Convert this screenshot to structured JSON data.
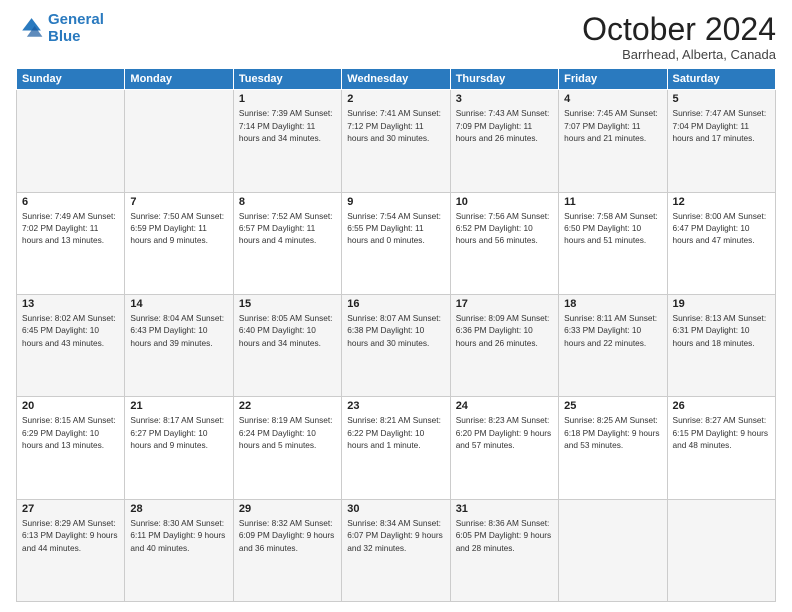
{
  "logo": {
    "line1": "General",
    "line2": "Blue"
  },
  "title": "October 2024",
  "location": "Barrhead, Alberta, Canada",
  "days_header": [
    "Sunday",
    "Monday",
    "Tuesday",
    "Wednesday",
    "Thursday",
    "Friday",
    "Saturday"
  ],
  "weeks": [
    [
      {
        "day": "",
        "info": ""
      },
      {
        "day": "",
        "info": ""
      },
      {
        "day": "1",
        "info": "Sunrise: 7:39 AM\nSunset: 7:14 PM\nDaylight: 11 hours\nand 34 minutes."
      },
      {
        "day": "2",
        "info": "Sunrise: 7:41 AM\nSunset: 7:12 PM\nDaylight: 11 hours\nand 30 minutes."
      },
      {
        "day": "3",
        "info": "Sunrise: 7:43 AM\nSunset: 7:09 PM\nDaylight: 11 hours\nand 26 minutes."
      },
      {
        "day": "4",
        "info": "Sunrise: 7:45 AM\nSunset: 7:07 PM\nDaylight: 11 hours\nand 21 minutes."
      },
      {
        "day": "5",
        "info": "Sunrise: 7:47 AM\nSunset: 7:04 PM\nDaylight: 11 hours\nand 17 minutes."
      }
    ],
    [
      {
        "day": "6",
        "info": "Sunrise: 7:49 AM\nSunset: 7:02 PM\nDaylight: 11 hours\nand 13 minutes."
      },
      {
        "day": "7",
        "info": "Sunrise: 7:50 AM\nSunset: 6:59 PM\nDaylight: 11 hours\nand 9 minutes."
      },
      {
        "day": "8",
        "info": "Sunrise: 7:52 AM\nSunset: 6:57 PM\nDaylight: 11 hours\nand 4 minutes."
      },
      {
        "day": "9",
        "info": "Sunrise: 7:54 AM\nSunset: 6:55 PM\nDaylight: 11 hours\nand 0 minutes."
      },
      {
        "day": "10",
        "info": "Sunrise: 7:56 AM\nSunset: 6:52 PM\nDaylight: 10 hours\nand 56 minutes."
      },
      {
        "day": "11",
        "info": "Sunrise: 7:58 AM\nSunset: 6:50 PM\nDaylight: 10 hours\nand 51 minutes."
      },
      {
        "day": "12",
        "info": "Sunrise: 8:00 AM\nSunset: 6:47 PM\nDaylight: 10 hours\nand 47 minutes."
      }
    ],
    [
      {
        "day": "13",
        "info": "Sunrise: 8:02 AM\nSunset: 6:45 PM\nDaylight: 10 hours\nand 43 minutes."
      },
      {
        "day": "14",
        "info": "Sunrise: 8:04 AM\nSunset: 6:43 PM\nDaylight: 10 hours\nand 39 minutes."
      },
      {
        "day": "15",
        "info": "Sunrise: 8:05 AM\nSunset: 6:40 PM\nDaylight: 10 hours\nand 34 minutes."
      },
      {
        "day": "16",
        "info": "Sunrise: 8:07 AM\nSunset: 6:38 PM\nDaylight: 10 hours\nand 30 minutes."
      },
      {
        "day": "17",
        "info": "Sunrise: 8:09 AM\nSunset: 6:36 PM\nDaylight: 10 hours\nand 26 minutes."
      },
      {
        "day": "18",
        "info": "Sunrise: 8:11 AM\nSunset: 6:33 PM\nDaylight: 10 hours\nand 22 minutes."
      },
      {
        "day": "19",
        "info": "Sunrise: 8:13 AM\nSunset: 6:31 PM\nDaylight: 10 hours\nand 18 minutes."
      }
    ],
    [
      {
        "day": "20",
        "info": "Sunrise: 8:15 AM\nSunset: 6:29 PM\nDaylight: 10 hours\nand 13 minutes."
      },
      {
        "day": "21",
        "info": "Sunrise: 8:17 AM\nSunset: 6:27 PM\nDaylight: 10 hours\nand 9 minutes."
      },
      {
        "day": "22",
        "info": "Sunrise: 8:19 AM\nSunset: 6:24 PM\nDaylight: 10 hours\nand 5 minutes."
      },
      {
        "day": "23",
        "info": "Sunrise: 8:21 AM\nSunset: 6:22 PM\nDaylight: 10 hours\nand 1 minute."
      },
      {
        "day": "24",
        "info": "Sunrise: 8:23 AM\nSunset: 6:20 PM\nDaylight: 9 hours\nand 57 minutes."
      },
      {
        "day": "25",
        "info": "Sunrise: 8:25 AM\nSunset: 6:18 PM\nDaylight: 9 hours\nand 53 minutes."
      },
      {
        "day": "26",
        "info": "Sunrise: 8:27 AM\nSunset: 6:15 PM\nDaylight: 9 hours\nand 48 minutes."
      }
    ],
    [
      {
        "day": "27",
        "info": "Sunrise: 8:29 AM\nSunset: 6:13 PM\nDaylight: 9 hours\nand 44 minutes."
      },
      {
        "day": "28",
        "info": "Sunrise: 8:30 AM\nSunset: 6:11 PM\nDaylight: 9 hours\nand 40 minutes."
      },
      {
        "day": "29",
        "info": "Sunrise: 8:32 AM\nSunset: 6:09 PM\nDaylight: 9 hours\nand 36 minutes."
      },
      {
        "day": "30",
        "info": "Sunrise: 8:34 AM\nSunset: 6:07 PM\nDaylight: 9 hours\nand 32 minutes."
      },
      {
        "day": "31",
        "info": "Sunrise: 8:36 AM\nSunset: 6:05 PM\nDaylight: 9 hours\nand 28 minutes."
      },
      {
        "day": "",
        "info": ""
      },
      {
        "day": "",
        "info": ""
      }
    ]
  ]
}
